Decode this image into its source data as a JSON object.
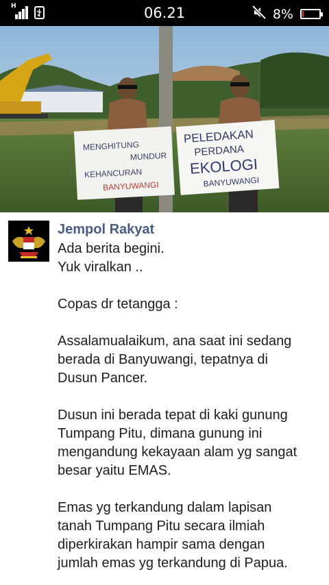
{
  "status_bar": {
    "network_type": "H",
    "time": "06.21",
    "battery_percent": "8%",
    "battery_level": 0.08,
    "icons": [
      "signal-icon",
      "usb-icon",
      "mute-icon",
      "battery-icon"
    ]
  },
  "photo": {
    "sign_left": [
      "MENGHITUNG",
      "MUNDUR",
      "KEHANCURAN",
      "BANYUWANGI"
    ],
    "sign_right": [
      "PELEDAKAN",
      "PERDANA",
      "EKOLOGI",
      "BANYUWANGI"
    ]
  },
  "post": {
    "author": "Jempol Rakyat",
    "lines": [
      "Ada berita begini.",
      "Yuk viralkan ..",
      "",
      "Copas dr tetangga :",
      "",
      "Assalamualaikum, ana saat ini sedang",
      "berada di Banyuwangi, tepatnya di",
      "Dusun Pancer.",
      "",
      "Dusun ini berada tepat di kaki gunung",
      "Tumpang Pitu, dimana gunung ini",
      "mengandung kekayaan alam yg sangat",
      "besar yaitu EMAS.",
      "",
      "Emas yg terkandung dalam lapisan",
      "tanah Tumpang Pitu secara ilmiah",
      "diperkirakan hampir sama dengan",
      "jumlah emas yg terkandung di Papua."
    ]
  }
}
